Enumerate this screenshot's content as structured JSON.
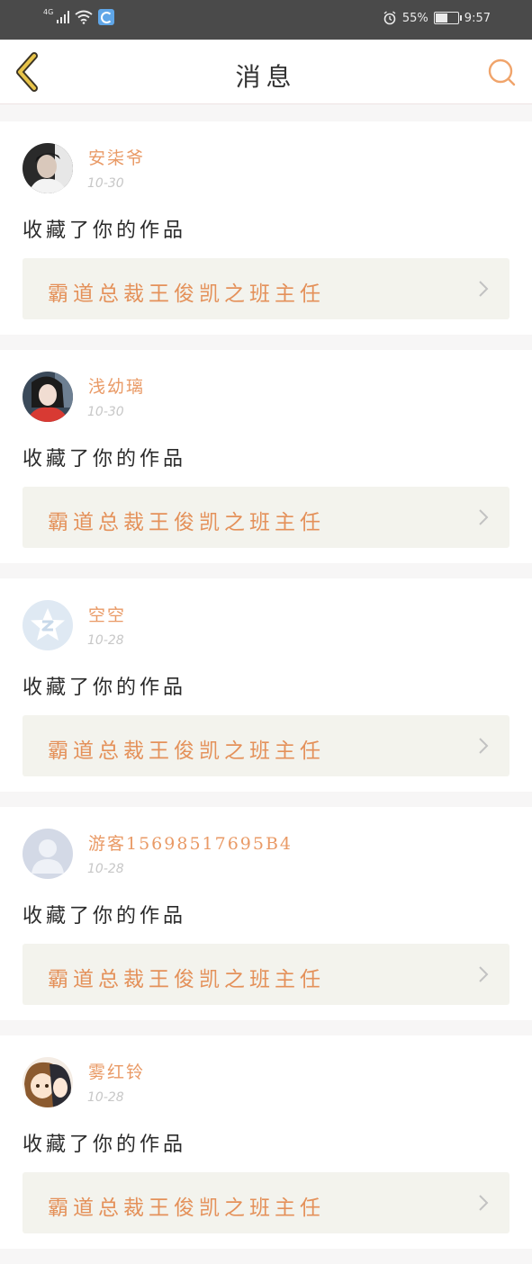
{
  "status_bar": {
    "network": "4G",
    "battery": "55%",
    "battery_level": 0.55,
    "time": "9:57",
    "icons": [
      "signal-icon",
      "wifi-icon",
      "app-notification-icon",
      "alarm-icon",
      "battery-icon"
    ]
  },
  "header": {
    "title": "消息",
    "back_icon": "chevron-left-icon",
    "search_icon": "search-icon"
  },
  "colors": {
    "accent": "#e99a66",
    "back_icon": "#e8c44a",
    "work_bg": "#f3f3ed",
    "page_bg": "#f7f6f6"
  },
  "messages": [
    {
      "user": "安柒爷",
      "time": "10-30",
      "action": "收藏了你的作品",
      "work": "霸道总裁王俊凯之班主任",
      "avatar": "photo-avatar-dark"
    },
    {
      "user": "浅幼璃",
      "time": "10-30",
      "action": "收藏了你的作品",
      "work": "霸道总裁王俊凯之班主任",
      "avatar": "photo-avatar-red"
    },
    {
      "user": "空空",
      "time": "10-28",
      "action": "收藏了你的作品",
      "work": "霸道总裁王俊凯之班主任",
      "avatar": "qzone-avatar"
    },
    {
      "user": "游客15698517695B4",
      "time": "10-28",
      "action": "收藏了你的作品",
      "work": "霸道总裁王俊凯之班主任",
      "avatar": "default-avatar"
    },
    {
      "user": "雾红铃",
      "time": "10-28",
      "action": "收藏了你的作品",
      "work": "霸道总裁王俊凯之班主任",
      "avatar": "anime-avatar"
    }
  ]
}
